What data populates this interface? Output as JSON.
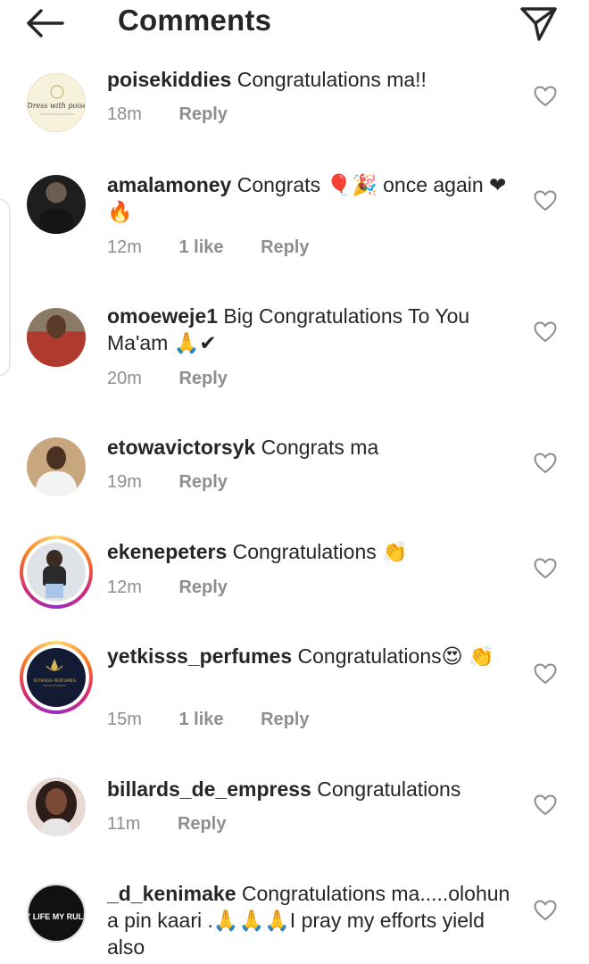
{
  "header": {
    "title": "Comments",
    "back_icon": "arrow-left-icon",
    "share_icon": "paper-plane-icon"
  },
  "colors": {
    "text": "#262626",
    "muted": "#8e8e8e",
    "story_ring": [
      "#feda75",
      "#fa7e1e",
      "#d62976",
      "#962fbf"
    ]
  },
  "comments": [
    {
      "username": "poisekiddies",
      "text": "Congratulations ma!!",
      "time": "18m",
      "likes": "",
      "reply": "Reply",
      "avatar_text": "Dress with poise"
    },
    {
      "username": "amalamoney",
      "text": "Congrats 🎈🎉 once again ❤🔥",
      "time": "12m",
      "likes": "1 like",
      "reply": "Reply",
      "avatar_text": ""
    },
    {
      "username": "omoeweje1",
      "text": "Big Congratulations To You Ma'am 🙏✔",
      "time": "20m",
      "likes": "",
      "reply": "Reply",
      "avatar_text": ""
    },
    {
      "username": "etowavictorsyk",
      "text": "Congrats ma",
      "time": "19m",
      "likes": "",
      "reply": "Reply",
      "avatar_text": ""
    },
    {
      "username": "ekenepeters",
      "text": "Congratulations 👏",
      "time": "12m",
      "likes": "",
      "reply": "Reply",
      "avatar_text": ""
    },
    {
      "username": "yetkisss_perfumes",
      "text": "Congratulations😍 👏",
      "time": "15m",
      "likes": "1 like",
      "reply": "Reply",
      "avatar_text": "YETKISSS PERFUMES"
    },
    {
      "username": "billards_de_empress",
      "text": "Congratulations",
      "time": "11m",
      "likes": "",
      "reply": "Reply",
      "avatar_text": ""
    },
    {
      "username": "_d_kenimake",
      "text": "Congratulations ma.....olohun a pin kaari .🙏🙏🙏I pray my efforts yield also",
      "time": "",
      "likes": "",
      "reply": "",
      "avatar_text": "MY LIFE MY RULES"
    }
  ]
}
